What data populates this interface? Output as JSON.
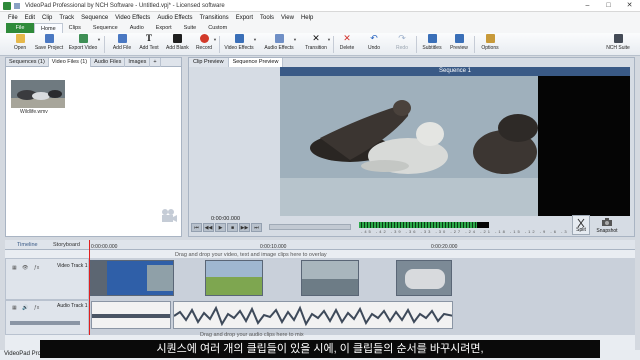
{
  "window": {
    "title": "VideoPad Professional by NCH Software - Untitled.vpj* - Licensed software",
    "min": "–",
    "max": "□",
    "close": "✕"
  },
  "menu": [
    "File",
    "Edit",
    "Clip",
    "Track",
    "Sequence",
    "Video Effects",
    "Audio Effects",
    "Transitions",
    "Export",
    "Tools",
    "View",
    "Help"
  ],
  "ribbon_tabs": [
    "File",
    "Home",
    "Clips",
    "Sequence",
    "Audio",
    "Export",
    "Suite",
    "Custom"
  ],
  "toolbar": {
    "open": "Open",
    "save_project": "Save Project",
    "export_video": "Export Video",
    "add_file": "Add File",
    "add_text": "Add Text",
    "add_blank": "Add Blank",
    "record": "Record",
    "video_effects": "Video Effects",
    "audio_effects": "Audio Effects",
    "transition": "Transition",
    "delete": "Delete",
    "undo": "Undo",
    "redo": "Redo",
    "subtitles": "Subtitles",
    "preview": "Preview",
    "options": "Options",
    "nch_suite": "NCH Suite"
  },
  "bin": {
    "tabs": [
      "Sequences (1)",
      "Video Files (1)",
      "Audio Files",
      "Images",
      "+"
    ],
    "clip_name": "Wildlife.wmv"
  },
  "preview": {
    "tabs": [
      "Clip Preview",
      "Sequence Preview"
    ],
    "sequence_title": "Sequence 1",
    "timecode": "0:00:00.000",
    "split": "Split",
    "snapshot": "Snapshot",
    "meter_scale": "-45 -42 -39 -36 -33 -30 -27 -24 -21 -18 -15 -12 -9 -6 -3 0"
  },
  "timeline": {
    "tabs": [
      "Timeline",
      "Storyboard"
    ],
    "ticks": [
      "0:00:00.000",
      "0:00:10.000",
      "0:00:20.000"
    ],
    "video_track": "Video Track 1",
    "audio_track": "Audio Track 1",
    "drop_video_hint": "Drag and drop your video, text and image clips here to overlay",
    "drop_audio_hint": "Drag and drop your audio clips here to mix"
  },
  "status": "VideoPad Professional",
  "subtitle": "시퀀스에 여러 개의 클립들이 있을 시에, 이 클립들의 순서를 바꾸시려면,",
  "colors": {
    "file_tab": "#2f8a3a",
    "sequence_title_bar": "#3a5a86",
    "playhead": "#e02020",
    "meter": "#2ca84a"
  }
}
